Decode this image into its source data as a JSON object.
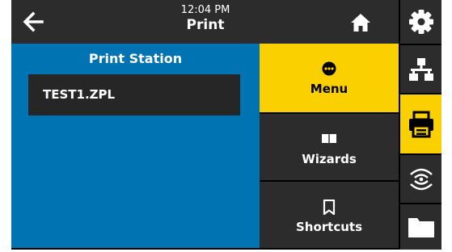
{
  "header": {
    "time": "12:04 PM",
    "title": "Print",
    "back_icon": "arrow-left-icon",
    "home_icon": "home-icon"
  },
  "print_station": {
    "title": "Print Station",
    "files": [
      "TEST1.ZPL"
    ]
  },
  "menu": [
    {
      "label": "Menu",
      "icon": "menu-dots-icon",
      "selected": true
    },
    {
      "label": "Wizards",
      "icon": "book-icon",
      "selected": false
    },
    {
      "label": "Shortcuts",
      "icon": "bookmark-icon",
      "selected": false
    }
  ],
  "sidebar": [
    {
      "icon": "gear-icon",
      "selected": false
    },
    {
      "icon": "network-icon",
      "selected": false
    },
    {
      "icon": "printer-icon",
      "selected": true
    },
    {
      "icon": "rfid-icon",
      "selected": false
    },
    {
      "icon": "folder-icon",
      "selected": false
    }
  ],
  "colors": {
    "accent": "#fbd000",
    "panel": "#0074b3",
    "dark": "#2c2c2c",
    "frame": "#000000"
  }
}
